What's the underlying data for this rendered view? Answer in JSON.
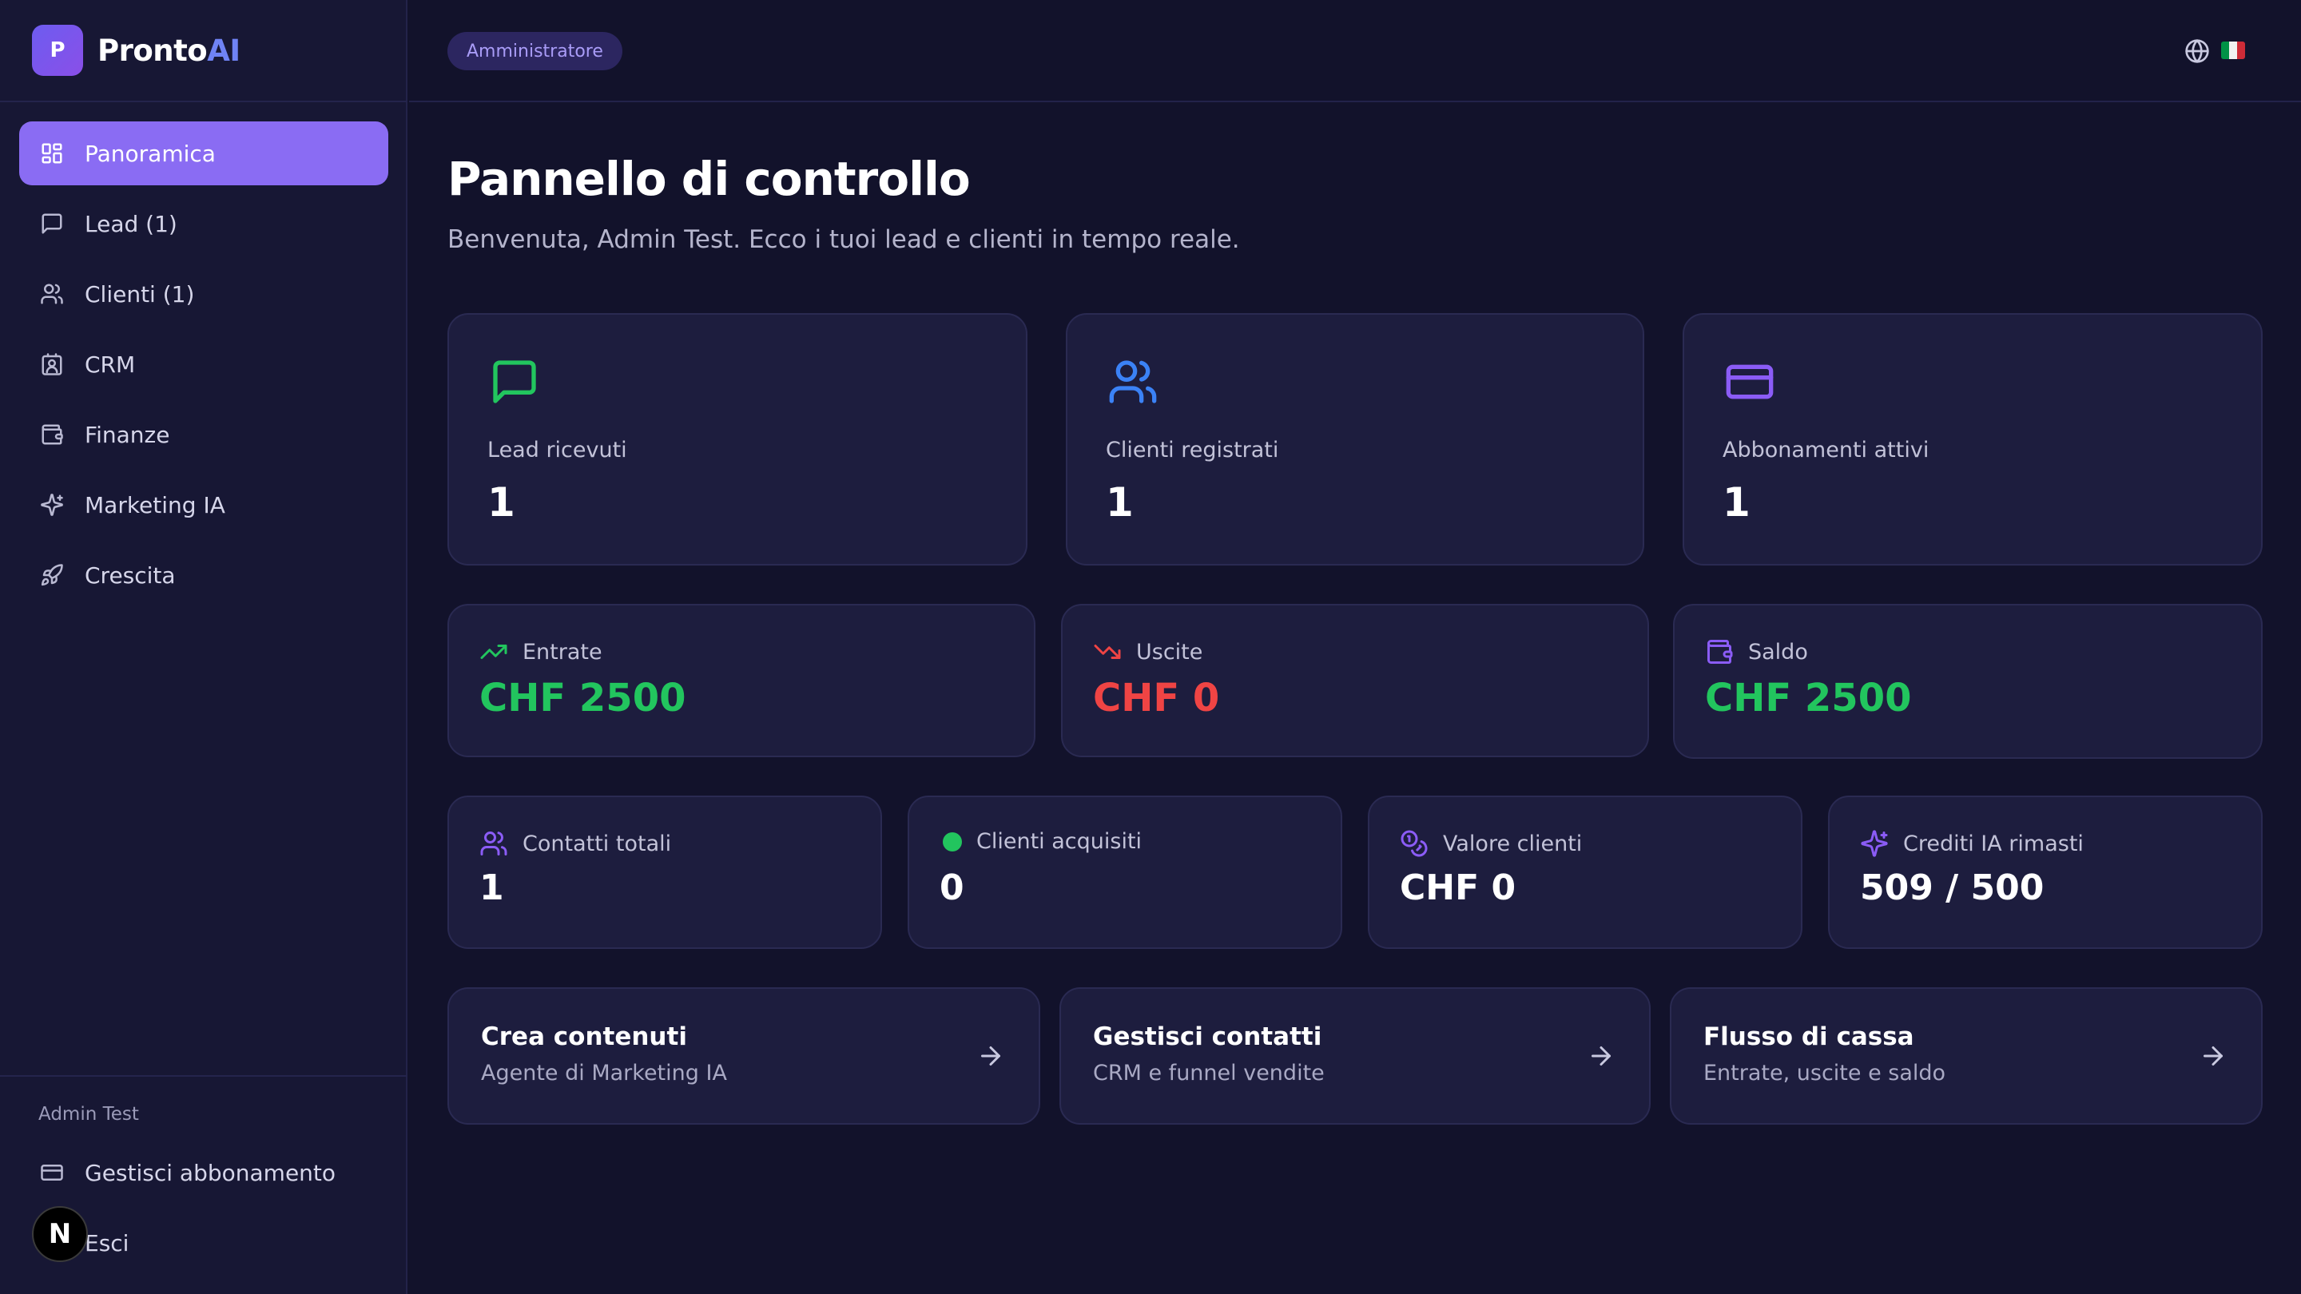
{
  "brand": {
    "logo_letter": "P",
    "name_main": "Pronto",
    "name_accent": "AI"
  },
  "sidebar": {
    "items": [
      {
        "label": "Panoramica",
        "icon": "grid-icon",
        "active": true
      },
      {
        "label": "Lead (1)",
        "icon": "message-square-icon"
      },
      {
        "label": "Clienti (1)",
        "icon": "users-icon"
      },
      {
        "label": "CRM",
        "icon": "contact-icon"
      },
      {
        "label": "Finanze",
        "icon": "wallet-icon"
      },
      {
        "label": "Marketing IA",
        "icon": "sparkles-icon"
      },
      {
        "label": "Crescita",
        "icon": "rocket-icon"
      }
    ],
    "user_name": "Admin Test",
    "manage_subscription": "Gestisci abbonamento",
    "logout": "Esci",
    "n_badge": "N"
  },
  "topbar": {
    "role": "Amministratore",
    "language_icon": "globe-icon",
    "flag": "italy-flag"
  },
  "header": {
    "title": "Pannello di controllo",
    "subtitle": "Benvenuta, Admin Test. Ecco i tuoi lead e clienti in tempo reale."
  },
  "stats": [
    {
      "label": "Lead ricevuti",
      "value": "1",
      "icon": "message-square-icon",
      "color": "#22c55e"
    },
    {
      "label": "Clienti registrati",
      "value": "1",
      "icon": "users-icon",
      "color": "#3b82f6"
    },
    {
      "label": "Abbonamenti attivi",
      "value": "1",
      "icon": "credit-card-icon",
      "color": "#8b5cf6"
    }
  ],
  "finance": [
    {
      "label": "Entrate",
      "value": "CHF 2500",
      "icon": "trending-up-icon",
      "color": "#22c55e"
    },
    {
      "label": "Uscite",
      "value": "CHF 0",
      "icon": "trending-down-icon",
      "color": "#ef4444"
    },
    {
      "label": "Saldo",
      "value": "CHF 2500",
      "icon": "wallet-icon",
      "color": "#22c55e",
      "icon_color": "#8b5cf6"
    }
  ],
  "mini": [
    {
      "label": "Contatti totali",
      "value": "1",
      "icon": "users-icon"
    },
    {
      "label": "Clienti acquisiti",
      "value": "0",
      "icon": "green-dot-icon"
    },
    {
      "label": "Valore clienti",
      "value": "CHF 0",
      "icon": "coins-icon"
    },
    {
      "label": "Crediti IA rimasti",
      "value": "509 / 500",
      "icon": "sparkles-icon"
    }
  ],
  "actions": [
    {
      "title": "Crea contenuti",
      "subtitle": "Agente di Marketing IA"
    },
    {
      "title": "Gestisci contatti",
      "subtitle": "CRM e funnel vendite"
    },
    {
      "title": "Flusso di cassa",
      "subtitle": "Entrate, uscite e saldo"
    }
  ],
  "colors": {
    "accent": "#8a6cf3",
    "background": "#12122b",
    "card": "#1d1d3e",
    "positive": "#22c55e",
    "negative": "#ef4444"
  }
}
